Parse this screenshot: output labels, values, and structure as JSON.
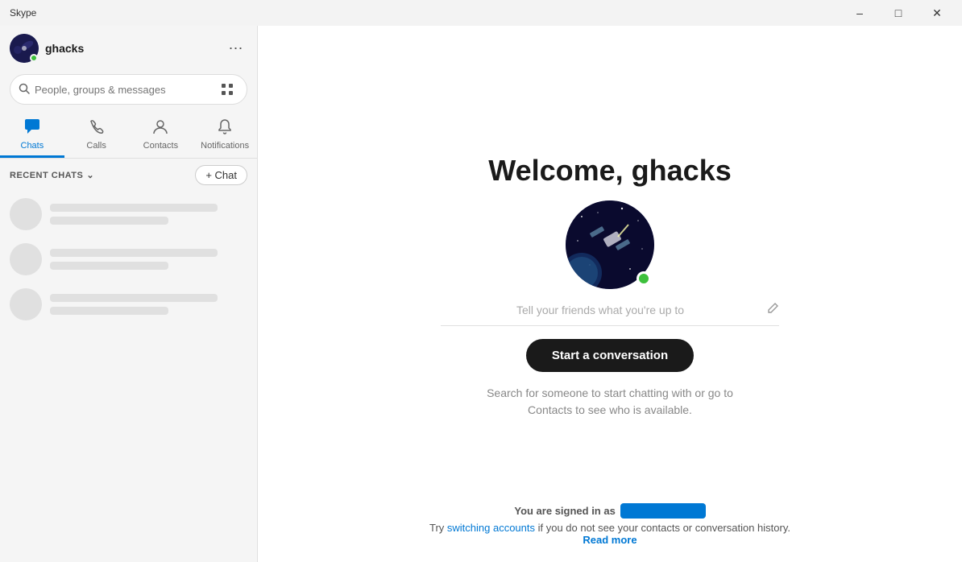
{
  "app": {
    "title": "Skype"
  },
  "titlebar": {
    "title": "Skype",
    "minimize_label": "minimize",
    "maximize_label": "maximize",
    "close_label": "close"
  },
  "sidebar": {
    "user": {
      "name": "ghacks",
      "online": true
    },
    "search": {
      "placeholder": "People, groups & messages"
    },
    "nav_tabs": [
      {
        "id": "chats",
        "label": "Chats",
        "active": true
      },
      {
        "id": "calls",
        "label": "Calls",
        "active": false
      },
      {
        "id": "contacts",
        "label": "Contacts",
        "active": false
      },
      {
        "id": "notifications",
        "label": "Notifications",
        "active": false
      }
    ],
    "recent_chats": {
      "label": "RECENT CHATS"
    },
    "new_chat_button": "+ Chat"
  },
  "main": {
    "welcome_title": "Welcome, ghacks",
    "status_placeholder": "Tell your friends what you're up to",
    "start_conversation_button": "Start a conversation",
    "helper_text_line1": "Search for someone to start chatting with or go to",
    "helper_text_line2": "Contacts to see who is available.",
    "signed_in_label": "You are signed in as",
    "switch_accounts_text": "switching accounts",
    "signed_in_suffix": " if you do not see your contacts or conversation history.",
    "try_prefix": "Try ",
    "read_more": "Read more"
  }
}
